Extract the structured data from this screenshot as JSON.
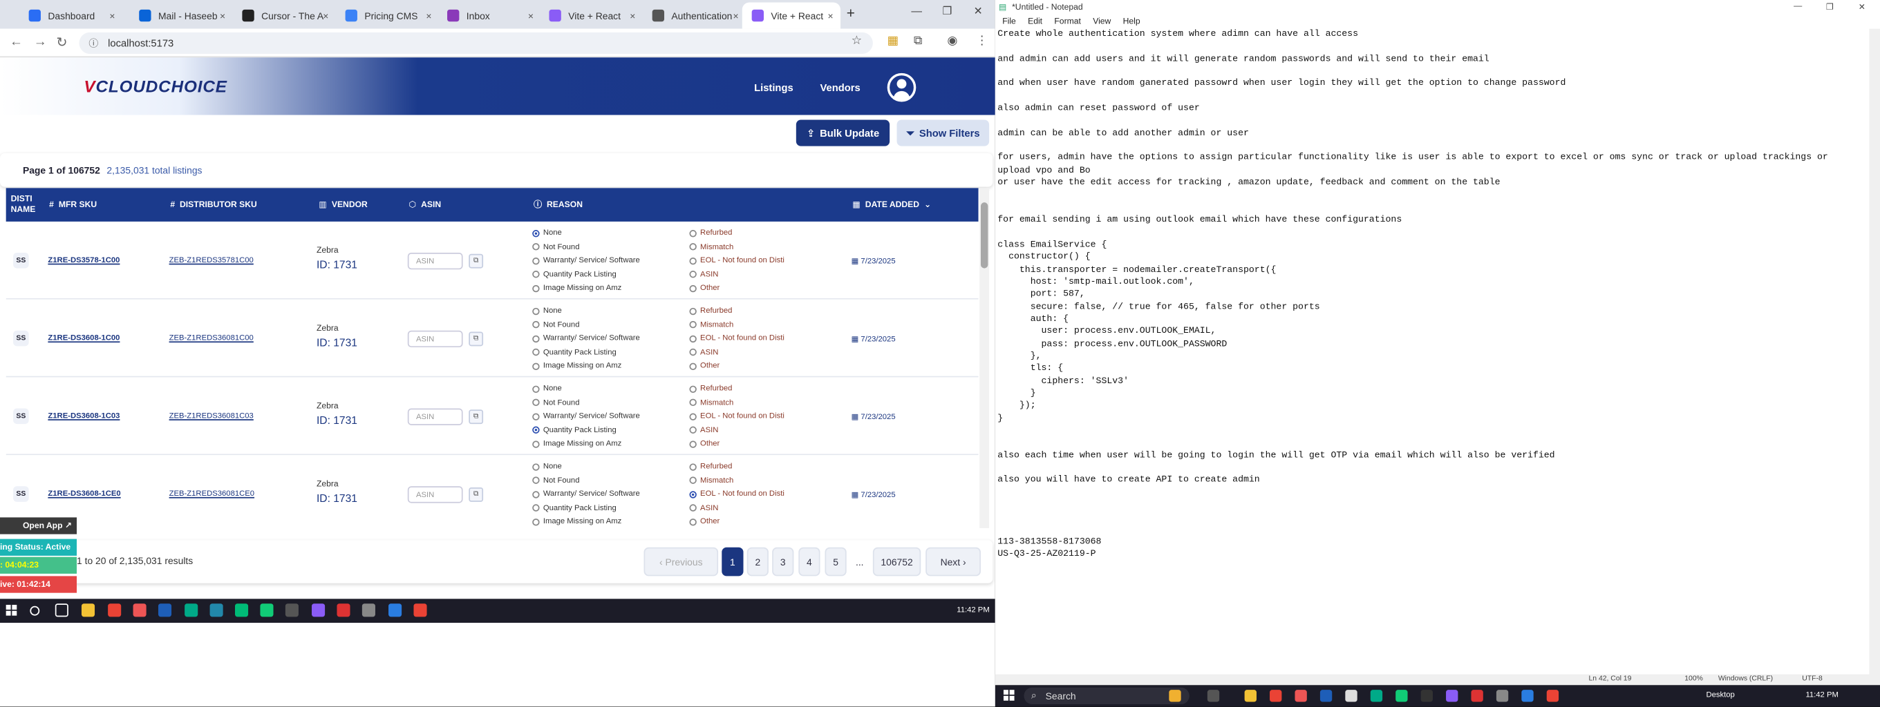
{
  "browser": {
    "tabs": [
      {
        "label": "Dashboard",
        "color": "#2a6df4"
      },
      {
        "label": "Mail - Haseeb",
        "color": "#0a64d8"
      },
      {
        "label": "Cursor - The A",
        "color": "#222222"
      },
      {
        "label": "Pricing CMS",
        "color": "#3b82f6"
      },
      {
        "label": "Inbox",
        "color": "#8a3ab9"
      },
      {
        "label": "Vite + React",
        "color": "#8a5cf6"
      },
      {
        "label": "Authentication",
        "color": "#555555"
      },
      {
        "label": "Vite + React",
        "color": "#8a5cf6"
      }
    ],
    "close_glyph": "×",
    "new_tab": "+",
    "url": "localhost:5173"
  },
  "app": {
    "logo_prefix": "V",
    "logo_text": "CLOUDCHOICE",
    "nav": [
      "Listings",
      "Vendors"
    ],
    "bulk_update": "Bulk Update",
    "show_filters": "Show Filters",
    "page_label": "Page 1 of 106752",
    "total_listings": "2,135,031 total listings",
    "columns": {
      "disti": "DISTI NAME",
      "mfr": "MFR SKU",
      "dist": "DISTRIBUTOR SKU",
      "vendor": "VENDOR",
      "asin": "ASIN",
      "reason": "REASON",
      "date": "DATE ADDED"
    },
    "reason_left": [
      "None",
      "Not Found",
      "Warranty/ Service/ Software",
      "Quantity Pack Listing",
      "Image Missing on Amz"
    ],
    "reason_right": [
      "Refurbed",
      "Mismatch",
      "EOL - Not found on Disti",
      "ASIN",
      "Other"
    ],
    "asin_placeholder": "ASIN",
    "rows": [
      {
        "disti": "SS",
        "mfr": "Z1RE-DS3578-1C00",
        "dist": "ZEB-Z1REDS35781C00",
        "vendor": "Zebra",
        "vendor_id": "ID: 1731",
        "selected": "None",
        "date": "7/23/2025"
      },
      {
        "disti": "SS",
        "mfr": "Z1RE-DS3608-1C00",
        "dist": "ZEB-Z1REDS36081C00",
        "vendor": "Zebra",
        "vendor_id": "ID: 1731",
        "selected": "",
        "date": "7/23/2025"
      },
      {
        "disti": "SS",
        "mfr": "Z1RE-DS3608-1C03",
        "dist": "ZEB-Z1REDS36081C03",
        "vendor": "Zebra",
        "vendor_id": "ID: 1731",
        "selected": "Quantity Pack Listing",
        "date": "7/23/2025"
      },
      {
        "disti": "SS",
        "mfr": "Z1RE-DS3608-1CE0",
        "dist": "ZEB-Z1REDS36081CE0",
        "vendor": "Zebra",
        "vendor_id": "ID: 1731",
        "selected": "EOL - Not found on Disti",
        "date": "7/23/2025"
      }
    ],
    "results_text": "1 to 20 of 2,135,031 results",
    "pager": {
      "previous": "‹ Previous",
      "pages": [
        "1",
        "2",
        "3",
        "4",
        "5"
      ],
      "ellipsis": "...",
      "last": "106752",
      "next": "Next ›",
      "current": "1"
    }
  },
  "overlay": {
    "open_app": "Open App ↗",
    "status": "ing Status: Active",
    "timer1": ": 04:04:23",
    "timer2": "ive: 01:42:14"
  },
  "taskbar_left": {
    "time": "11:42 PM"
  },
  "notepad": {
    "title": "*Untitled - Notepad",
    "menu": [
      "File",
      "Edit",
      "Format",
      "View",
      "Help"
    ],
    "content": "Create whole authentication system where adimn can have all access\n\nand admin can add users and it will generate random passwords and will send to their email\n\nand when user have random ganerated passowrd when user login they will get the option to change password\n\nalso admin can reset password of user\n\nadmin can be able to add another admin or user\n\nfor users, admin have the options to assign particular functionality like is user is able to export to excel or oms sync or track or upload trackings or\nupload vpo and Bo\nor user have the edit access for tracking , amazon update, feedback and comment on the table\n\n\nfor email sending i am using outlook email which have these configurations\n\nclass EmailService {\n  constructor() {\n    this.transporter = nodemailer.createTransport({\n      host: 'smtp-mail.outlook.com',\n      port: 587,\n      secure: false, // true for 465, false for other ports\n      auth: {\n        user: process.env.OUTLOOK_EMAIL,\n        pass: process.env.OUTLOOK_PASSWORD\n      },\n      tls: {\n        ciphers: 'SSLv3'\n      }\n    });\n}\n\n\nalso each time when user will be going to login the will get OTP via email which will also be verified\n\nalso you will have to create API to create admin\n\n\n\n\n113-3813558-8173068\nUS-Q3-25-AZ02119-P",
    "status": {
      "pos": "Ln 42, Col 19",
      "zoom": "100%",
      "eol": "Windows (CRLF)",
      "enc": "UTF-8"
    }
  },
  "taskbar_right": {
    "search": "Search",
    "desktop": "Desktop",
    "time": "11:42 PM"
  }
}
